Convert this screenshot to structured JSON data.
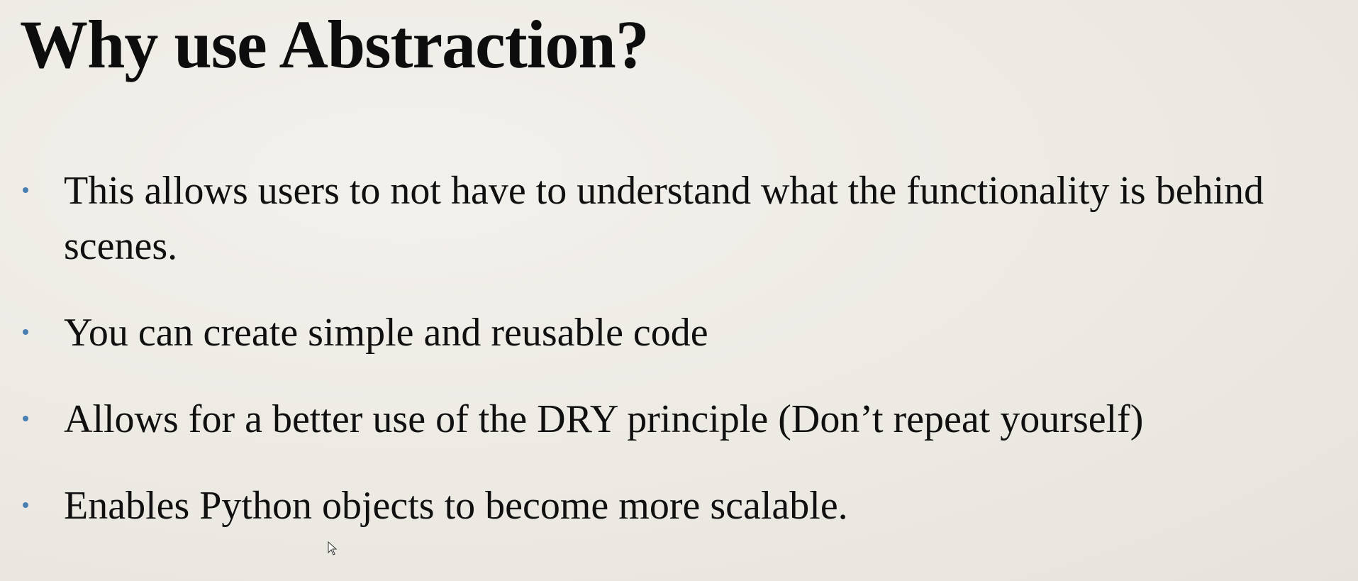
{
  "slide": {
    "title": "Why use Abstraction?",
    "bullets": [
      "This allows users to not have to understand what the functionality is behind scenes.",
      "You can create simple and reusable code",
      "Allows for a better use of the DRY principle (Don’t repeat yourself)",
      "Enables Python objects to become more scalable."
    ]
  },
  "colors": {
    "background": "#eeebe4",
    "text": "#111111",
    "bullet_dot": "#4a7fb3"
  },
  "icons": {
    "cursor": "mouse-pointer-icon",
    "bullet": "bullet-dot-icon"
  }
}
